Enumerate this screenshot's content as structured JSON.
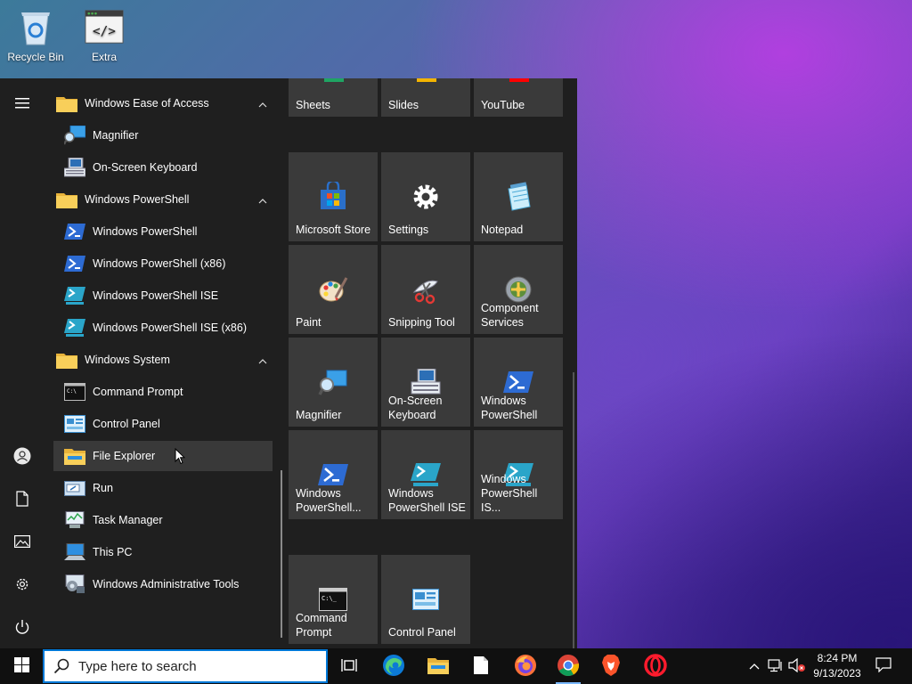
{
  "desktop": {
    "icons": [
      {
        "label": "Recycle Bin",
        "icon": "recycle-bin-icon"
      },
      {
        "label": "Extra",
        "icon": "code-file-icon"
      }
    ]
  },
  "start_menu": {
    "app_list": [
      {
        "label": "Windows Ease of Access",
        "type": "folder",
        "icon": "folder-icon"
      },
      {
        "label": "Magnifier",
        "type": "app",
        "icon": "magnifier-icon"
      },
      {
        "label": "On-Screen Keyboard",
        "type": "app",
        "icon": "keyboard-icon"
      },
      {
        "label": "Windows PowerShell",
        "type": "folder",
        "icon": "folder-icon"
      },
      {
        "label": "Windows PowerShell",
        "type": "app",
        "icon": "powershell-icon"
      },
      {
        "label": "Windows PowerShell (x86)",
        "type": "app",
        "icon": "powershell-icon"
      },
      {
        "label": "Windows PowerShell ISE",
        "type": "app",
        "icon": "powershell-ise-icon"
      },
      {
        "label": "Windows PowerShell ISE (x86)",
        "type": "app",
        "icon": "powershell-ise-icon"
      },
      {
        "label": "Windows System",
        "type": "folder",
        "icon": "folder-icon"
      },
      {
        "label": "Command Prompt",
        "type": "app",
        "icon": "command-prompt-icon"
      },
      {
        "label": "Control Panel",
        "type": "app",
        "icon": "control-panel-icon"
      },
      {
        "label": "File Explorer",
        "type": "app",
        "icon": "file-explorer-icon"
      },
      {
        "label": "Run",
        "type": "app",
        "icon": "run-icon"
      },
      {
        "label": "Task Manager",
        "type": "app",
        "icon": "task-manager-icon"
      },
      {
        "label": "This PC",
        "type": "app",
        "icon": "this-pc-icon"
      },
      {
        "label": "Windows Administrative Tools",
        "type": "app",
        "icon": "admin-tools-icon"
      }
    ],
    "tiles": [
      {
        "label": "Sheets",
        "icon": "sheets-icon",
        "color": "#1fa463"
      },
      {
        "label": "Slides",
        "icon": "slides-icon",
        "color": "#f4b400"
      },
      {
        "label": "YouTube",
        "icon": "youtube-icon",
        "color": "#ff0000"
      },
      {
        "label": "Microsoft Store",
        "icon": "store-icon"
      },
      {
        "label": "Settings",
        "icon": "gear-icon"
      },
      {
        "label": "Notepad",
        "icon": "notepad-icon"
      },
      {
        "label": "Paint",
        "icon": "paint-icon"
      },
      {
        "label": "Snipping Tool",
        "icon": "scissors-icon"
      },
      {
        "label": "Component Services",
        "icon": "component-services-icon"
      },
      {
        "label": "Magnifier",
        "icon": "magnifier-icon"
      },
      {
        "label": "On-Screen Keyboard",
        "icon": "keyboard-icon"
      },
      {
        "label": "Windows PowerShell",
        "icon": "powershell-icon"
      },
      {
        "label": "Windows PowerShell...",
        "icon": "powershell-icon"
      },
      {
        "label": "Windows PowerShell ISE",
        "icon": "powershell-ise-icon"
      },
      {
        "label": "Windows PowerShell IS...",
        "icon": "powershell-ise-icon"
      },
      {
        "label": "Command Prompt",
        "icon": "command-prompt-icon"
      },
      {
        "label": "Control Panel",
        "icon": "control-panel-icon"
      }
    ]
  },
  "taskbar": {
    "search_placeholder": "Type here to search",
    "apps": [
      "task-view-icon",
      "edge-icon",
      "file-explorer-icon",
      "file-icon",
      "firefox-icon",
      "chrome-icon",
      "brave-icon",
      "opera-icon"
    ],
    "clock_time": "8:24 PM",
    "clock_date": "9/13/2023"
  },
  "colors": {
    "accent": "#0078d7",
    "start_bg": "#1f1f1f",
    "tile_bg": "#3a3a3a",
    "taskbar_bg": "#101010"
  }
}
